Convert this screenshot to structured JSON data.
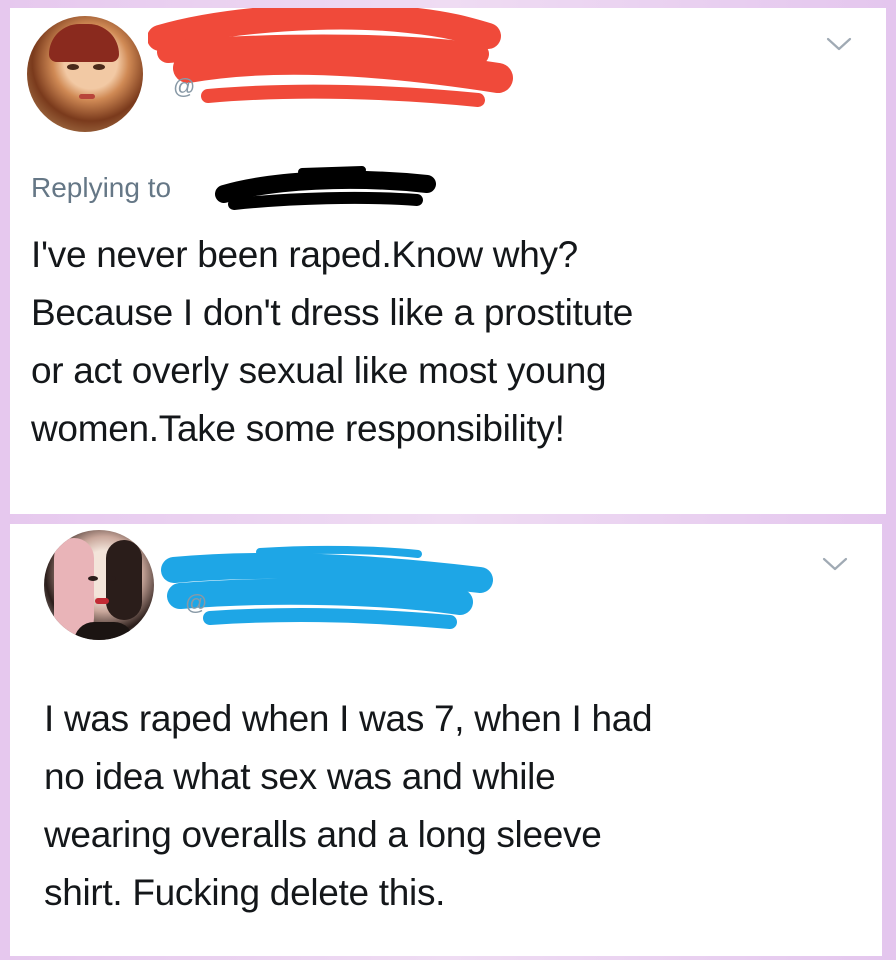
{
  "tweets": [
    {
      "display_name": "[redacted]",
      "handle_prefix": "@",
      "reply_label": "Replying to",
      "reply_to": "[redacted]",
      "text_lines": [
        "I've never been raped.Know why?",
        "Because I don't dress like a prostitute",
        "or act overly sexual like most young",
        "women.Take some responsibility!"
      ]
    },
    {
      "display_name": "[redacted]",
      "handle_prefix": "@",
      "text_lines": [
        "I was raped when I was 7, when I had",
        "no idea what sex was and while",
        "wearing overalls and a long sleeve",
        "shirt. Fucking delete this."
      ]
    }
  ],
  "redaction_colors": {
    "tweet1_name": "#f04a3a",
    "tweet1_reply": "#000000",
    "tweet2_name": "#1ea6e6"
  },
  "icons": [
    "chevron-down-icon",
    "avatar"
  ]
}
